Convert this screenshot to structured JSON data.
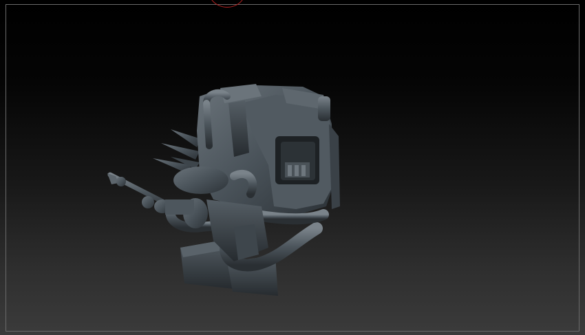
{
  "viewport": {
    "background_top": "#000000",
    "background_bottom": "#3b3b3b",
    "frame_color": "#6a6a6a",
    "brush_cursor_color": "#b02020"
  },
  "model": {
    "material_color": "#4a535a"
  }
}
